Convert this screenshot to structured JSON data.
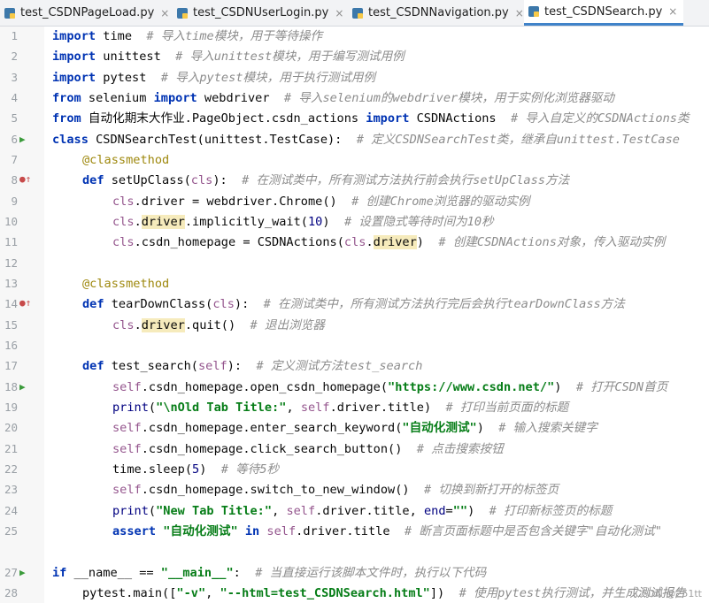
{
  "tabs": [
    {
      "label": "test_CSDNPageLoad.py",
      "active": false
    },
    {
      "label": "test_CSDNUserLogin.py",
      "active": false
    },
    {
      "label": "test_CSDNNavigation.py",
      "active": false
    },
    {
      "label": "test_CSDNSearch.py",
      "active": true
    }
  ],
  "tab_close_glyph": "×",
  "line_numbers": [
    "1",
    "2",
    "3",
    "4",
    "5",
    "6",
    "7",
    "8",
    "9",
    "10",
    "11",
    "12",
    "13",
    "14",
    "15",
    "16",
    "17",
    "18",
    "19",
    "20",
    "21",
    "22",
    "23",
    "24",
    "25",
    "",
    "27",
    "28"
  ],
  "code_lines": {
    "l1": {
      "kw1": "import",
      "t1": " time  ",
      "cm": "# 导入time模块，用于等待操作"
    },
    "l2": {
      "kw1": "import",
      "t1": " unittest  ",
      "cm": "# 导入unittest模块，用于编写测试用例"
    },
    "l3": {
      "kw1": "import",
      "t1": " pytest  ",
      "cm": "# 导入pytest模块，用于执行测试用例"
    },
    "l4": {
      "kw1": "from",
      "t1": " selenium ",
      "kw2": "import",
      "t2": " webdriver  ",
      "cm": "# 导入selenium的webdriver模块，用于实例化浏览器驱动"
    },
    "l5": {
      "kw1": "from",
      "t1": " 自动化期末大作业.PageObject.csdn_actions ",
      "kw2": "import",
      "t2": " CSDNActions  ",
      "cm": "# 导入自定义的CSDNActions类"
    },
    "l6": {
      "kw1": "class",
      "t1": " CSDNSearchTest(unittest.TestCase):  ",
      "cm": "# 定义CSDNSearchTest类，继承自unittest.TestCase"
    },
    "l7": {
      "dc": "@classmethod"
    },
    "l8": {
      "kw1": "def",
      "t1": " setUpClass(",
      "sf": "cls",
      "t2": "):  ",
      "cm": "# 在测试类中，所有测试方法执行前会执行setUpClass方法"
    },
    "l9": {
      "sf": "cls",
      "t1": ".driver = webdriver.Chrome()  ",
      "cm": "# 创建Chrome浏览器的驱动实例"
    },
    "l10": {
      "sf": "cls",
      "t1": ".",
      "hl": "driver",
      "t2": ".implicitly_wait(",
      "nb": "10",
      "t3": ")  ",
      "cm": "# 设置隐式等待时间为10秒"
    },
    "l11": {
      "sf": "cls",
      "t1": ".csdn_homepage = CSDNActions(",
      "sf2": "cls",
      "t2": ".",
      "hl": "driver",
      "t3": ")  ",
      "cm": "# 创建CSDNActions对象，传入驱动实例"
    },
    "l13": {
      "dc": "@classmethod"
    },
    "l14": {
      "kw1": "def",
      "t1": " tearDownClass(",
      "sf": "cls",
      "t2": "):  ",
      "cm": "# 在测试类中，所有测试方法执行完后会执行tearDownClass方法"
    },
    "l15": {
      "sf": "cls",
      "t1": ".",
      "hl": "driver",
      "t2": ".quit()  ",
      "cm": "# 退出浏览器"
    },
    "l17": {
      "kw1": "def",
      "t1": " test_search(",
      "sf": "self",
      "t2": "):  ",
      "cm": "# 定义测试方法test_search"
    },
    "l18": {
      "sf": "self",
      "t1": ".csdn_homepage.open_csdn_homepage(",
      "st": "\"https://www.csdn.net/\"",
      "t2": ")  ",
      "cm": "# 打开CSDN首页"
    },
    "l19": {
      "nb": "print",
      "t1": "(",
      "st": "\"\\nOld Tab Title:\"",
      "t2": ", ",
      "sf": "self",
      "t3": ".driver.title)  ",
      "cm": "# 打印当前页面的标题"
    },
    "l20": {
      "sf": "self",
      "t1": ".csdn_homepage.enter_search_keyword(",
      "st": "\"自动化测试\"",
      "t2": ")  ",
      "cm": "# 输入搜索关键字"
    },
    "l21": {
      "sf": "self",
      "t1": ".csdn_homepage.click_search_button()  ",
      "cm": "# 点击搜索按钮"
    },
    "l22": {
      "t1": "time.sleep(",
      "nb": "5",
      "t2": ")  ",
      "cm": "# 等待5秒"
    },
    "l23": {
      "sf": "self",
      "t1": ".csdn_homepage.switch_to_new_window()  ",
      "cm": "# 切换到新打开的标签页"
    },
    "l24": {
      "nb": "print",
      "t1": "(",
      "st": "\"New Tab Title:\"",
      "t2": ", ",
      "sf": "self",
      "t3": ".driver.title, ",
      "nb2": "end",
      "t4": "=",
      "st2": "\"\"",
      "t5": ")  ",
      "cm": "# 打印新标签页的标题"
    },
    "l25": {
      "kw1": "assert",
      "t1": " ",
      "st": "\"自动化测试\"",
      "t2": " ",
      "kw2": "in",
      "t3": " ",
      "sf": "self",
      "t4": ".driver.title  ",
      "cm": "# 断言页面标题中是否包含关键字\"自动化测试\""
    },
    "l27": {
      "kw1": "if",
      "t1": " __name__ == ",
      "st": "\"__main__\"",
      "t2": ":  ",
      "cm": "# 当直接运行该脚本文件时，执行以下代码"
    },
    "l28": {
      "t1": "pytest.main([",
      "st": "\"-v\"",
      "t2": ", ",
      "st2": "\"--html=test_CSDNSearch.html\"",
      "t3": "])  ",
      "cm": "# 使用pytest执行测试，并生成测试报告"
    }
  },
  "watermark": "CSDN @251tt",
  "colors": {
    "keyword": "#0033b3",
    "comment": "#8c8c8c",
    "string": "#067d17",
    "builtin": "#000080",
    "decorator": "#9e880d",
    "self": "#94558d",
    "highlight": "#f6ebbc",
    "tab_active": "#4083c9"
  },
  "icons": {
    "file": "python-file-icon",
    "run": "run-triangle-icon",
    "override": "override-arrow-icon"
  }
}
